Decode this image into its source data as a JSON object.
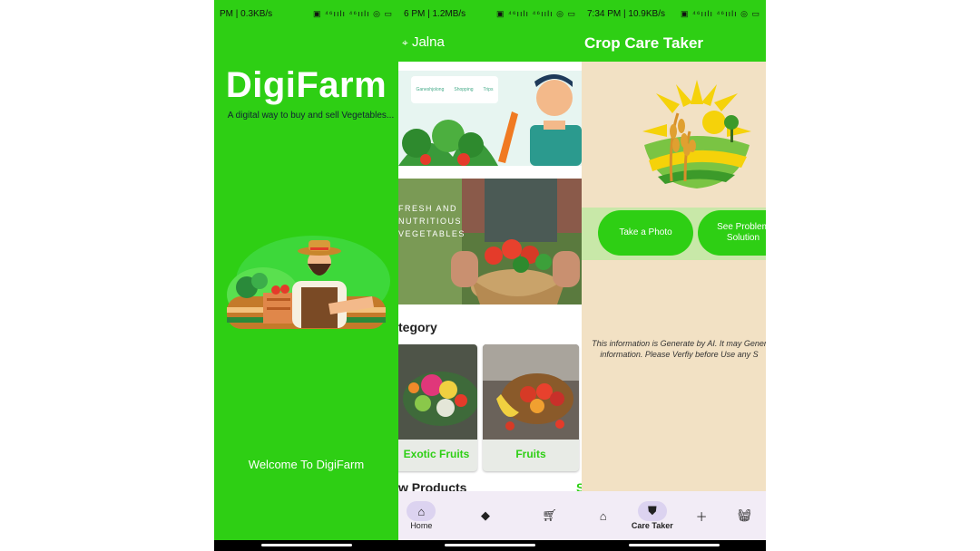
{
  "panel1": {
    "status": {
      "left": "PM | 0.3KB/s",
      "right": "▣ ⁴⁶ıılı ⁴⁶ıılı ◎ ▭"
    },
    "brand": "DigiFarm",
    "tagline": "A digital way to buy and sell Vegetables...",
    "welcome": "Welcome To DigiFarm"
  },
  "panel2": {
    "status": {
      "left": "6 PM | 1.2MB/s",
      "right": "▣ ⁴⁶ıılı ⁴⁶ıılı ◎ ▭"
    },
    "location": "Jalna",
    "banner1_tags": [
      "Ganeshjolong",
      "Shopping",
      "Trips"
    ],
    "banner2_text": "FRESH AND NUTRITIOUS VEGETABLES",
    "category_title": "tegory",
    "categories": [
      {
        "label": "Exotic Fruits"
      },
      {
        "label": "Fruits"
      }
    ],
    "new_products_title": "w Products",
    "see_all": "S",
    "nav": {
      "home": "Home"
    }
  },
  "panel3": {
    "status": {
      "left": "7:34 PM | 10.9KB/s",
      "right": "▣ ⁴⁶ıılı ⁴⁶ıılı ◎ ▭"
    },
    "title": "Crop Care Taker",
    "take_photo": "Take a Photo",
    "see_solution_line1": "See Problem",
    "see_solution_line2": "Solution",
    "disclaimer_line1": "This information is Generate by AI. It may Gener",
    "disclaimer_line2": "information. Please Verfiy before Use any S",
    "nav": {
      "care_taker": "Care Taker"
    }
  },
  "colors": {
    "primary": "#2ecf14",
    "cream": "#f2e1c4",
    "navbar": "#f2ecf6"
  }
}
